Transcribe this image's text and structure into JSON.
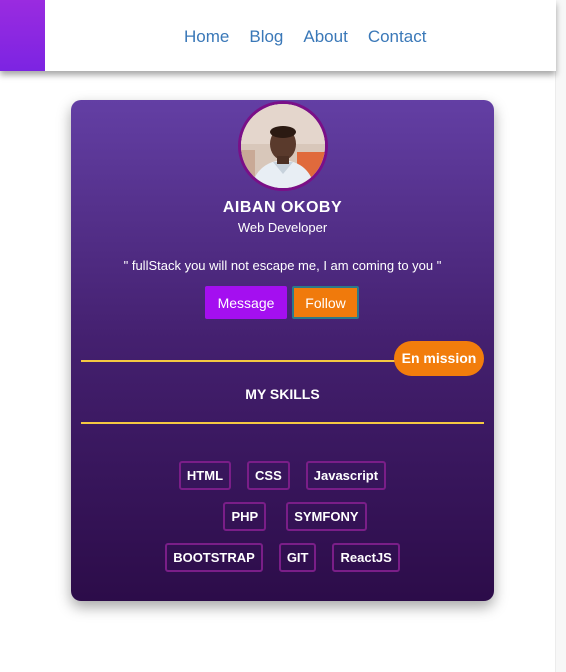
{
  "nav": {
    "items": [
      {
        "label": "Home"
      },
      {
        "label": "Blog"
      },
      {
        "label": "About"
      },
      {
        "label": "Contact"
      }
    ]
  },
  "profile": {
    "name": "AIBAN OKOBY",
    "role": "Web Developer",
    "quote": "\" fullStack you will not escape me, I am coming to you \"",
    "message_label": "Message",
    "follow_label": "Follow",
    "status_badge": "En mission"
  },
  "skills": {
    "title": "MY SKILLS",
    "rows": [
      [
        "HTML",
        "CSS",
        "Javascript"
      ],
      [
        "PHP",
        "SYMFONY"
      ],
      [
        "BOOTSTRAP",
        "GIT",
        "ReactJS"
      ]
    ]
  },
  "colors": {
    "accent": "#9a2be0",
    "nav_link": "#3a78b8",
    "message_button": "#a40ff0",
    "follow_button": "#f07a0c",
    "divider": "#f5c842",
    "skill_border": "#7a1e88"
  }
}
